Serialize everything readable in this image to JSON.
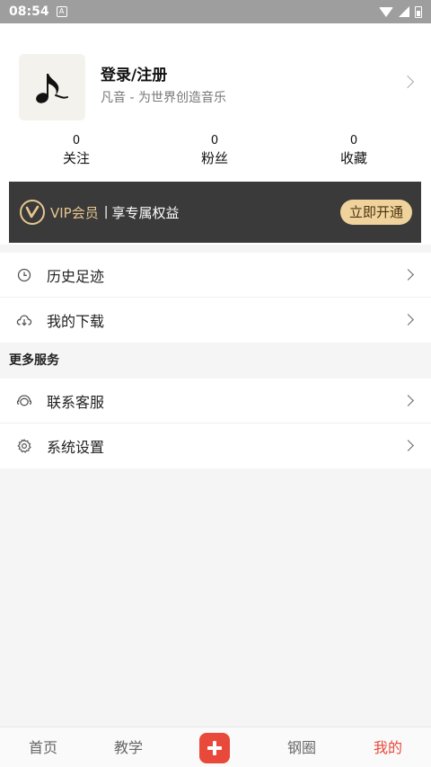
{
  "status_bar": {
    "time": "08:54",
    "notification_icon": "A"
  },
  "profile": {
    "title": "登录/注册",
    "subtitle": "凡音 - 为世界创造音乐",
    "avatar_icon": "music-note-icon"
  },
  "stats": [
    {
      "value": "0",
      "label": "关注"
    },
    {
      "value": "0",
      "label": "粉丝"
    },
    {
      "value": "0",
      "label": "收藏"
    }
  ],
  "vip": {
    "name": "VIP会员",
    "separator": "|",
    "benefit": "享专属权益",
    "button_label": "立即开通"
  },
  "menu_main": [
    {
      "label": "历史足迹",
      "icon": "clock-icon"
    },
    {
      "label": "我的下载",
      "icon": "cloud-download-icon"
    }
  ],
  "section_title": "更多服务",
  "menu_services": [
    {
      "label": "联系客服",
      "icon": "headset-icon"
    },
    {
      "label": "系统设置",
      "icon": "gear-icon"
    }
  ],
  "tabs": {
    "home": "首页",
    "teach": "教学",
    "circle": "钢圈",
    "mine": "我的"
  },
  "colors": {
    "accent": "#e8493a",
    "vip_gold": "#e7c690",
    "vip_bg": "#3a3a3a"
  }
}
